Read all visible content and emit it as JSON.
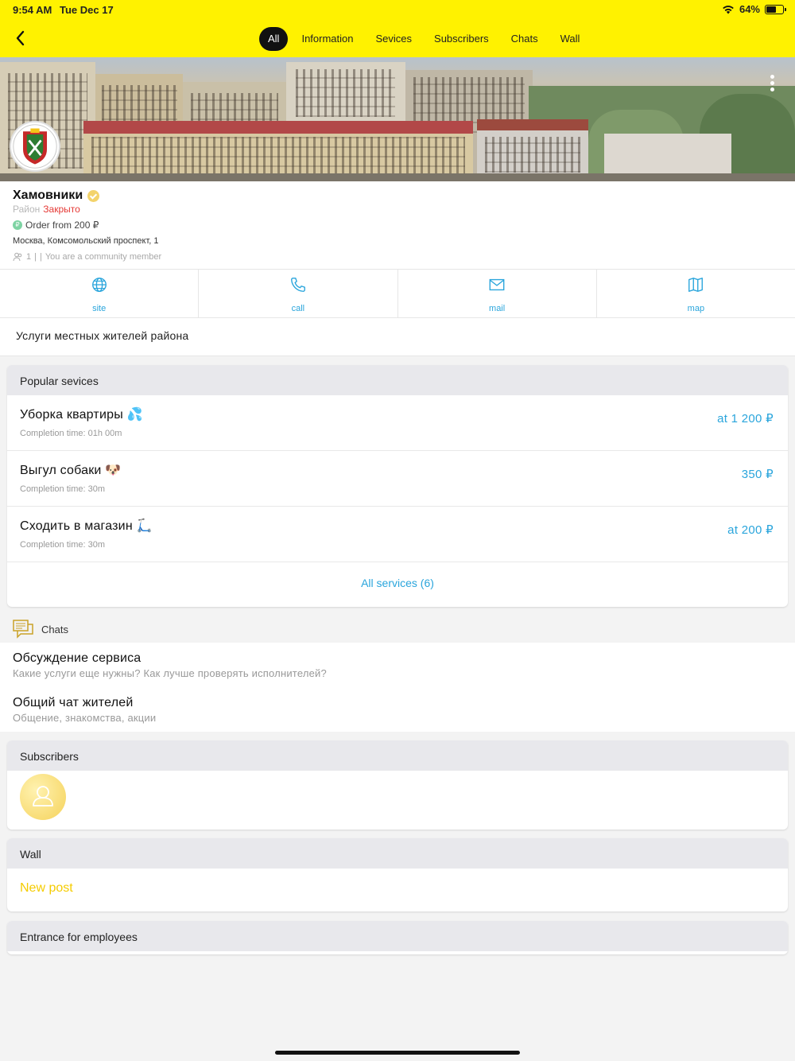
{
  "status_bar": {
    "time": "9:54 AM",
    "date": "Tue Dec 17",
    "battery": "64%",
    "battery_level": 0.64
  },
  "nav": {
    "tabs": [
      {
        "label": "All",
        "active": true
      },
      {
        "label": "Information"
      },
      {
        "label": "Sevices"
      },
      {
        "label": "Subscribers"
      },
      {
        "label": "Chats"
      },
      {
        "label": "Wall"
      }
    ]
  },
  "profile": {
    "name": "Хамовники",
    "type": "Район",
    "status": "Закрыто",
    "order": "Order from 200 ₽",
    "address": "Москва, Комсомольский проспект, 1",
    "members_count": "1",
    "membership": "You are a community member"
  },
  "actions": [
    {
      "label": "site",
      "icon": "globe-icon"
    },
    {
      "label": "call",
      "icon": "phone-icon"
    },
    {
      "label": "mail",
      "icon": "mail-icon"
    },
    {
      "label": "map",
      "icon": "map-icon"
    }
  ],
  "description": "Услуги местных жителей района",
  "popular": {
    "title": "Popular sevices",
    "services": [
      {
        "name": "Уборка квартиры 💦",
        "time": "Completion time: 01h 00m",
        "price": "at 1 200 ₽"
      },
      {
        "name": "Выгул собаки 🐶",
        "time": "Completion time: 30m",
        "price": "350 ₽"
      },
      {
        "name": "Сходить в магазин 🛴",
        "time": "Completion time: 30m",
        "price": "at 200 ₽"
      }
    ],
    "all_label": "All services (6)"
  },
  "chats": {
    "title": "Chats",
    "items": [
      {
        "name": "Обсуждение сервиса",
        "subtitle": "Какие услуги еще нужны? Как лучше проверять исполнителей?"
      },
      {
        "name": "Общий чат жителей",
        "subtitle": "Общение, знакомства, акции"
      }
    ]
  },
  "subscribers": {
    "title": "Subscribers"
  },
  "wall": {
    "title": "Wall",
    "new_post": "New post"
  },
  "employees": {
    "title": "Entrance for employees"
  },
  "colors": {
    "accent_yellow": "#fff200",
    "link_blue": "#2aa5dc",
    "closed_red": "#e53935"
  }
}
